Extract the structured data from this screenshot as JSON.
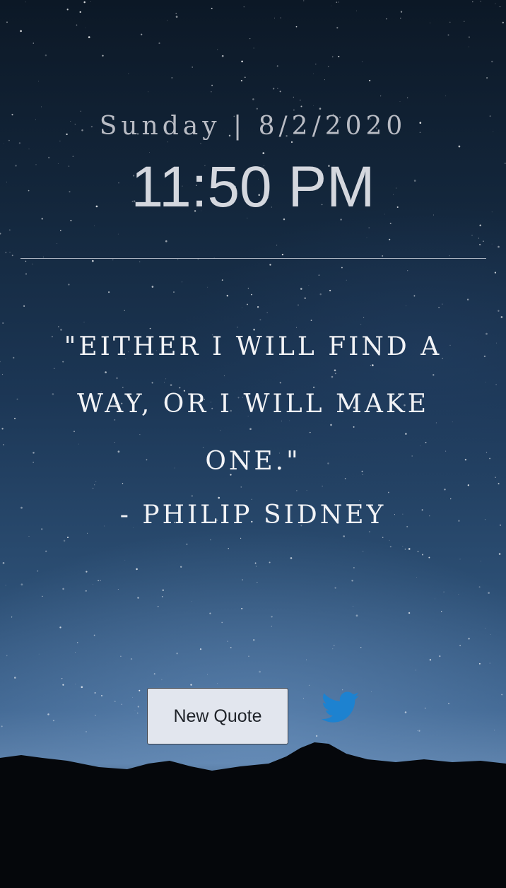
{
  "header": {
    "day": "Sunday",
    "separator": "|",
    "date": "8/2/2020",
    "time": "11:50 PM"
  },
  "quote": {
    "text": "\"Either I will find a way, or I will make one.\"",
    "author": "- Philip Sidney"
  },
  "actions": {
    "new_quote_label": "New Quote",
    "share_icon": "twitter-icon"
  },
  "colors": {
    "text": "#f2f3f6",
    "muted_text": "#b9bcc4",
    "button_bg": "#e2e6ee",
    "twitter_blue": "#1d82d0"
  }
}
